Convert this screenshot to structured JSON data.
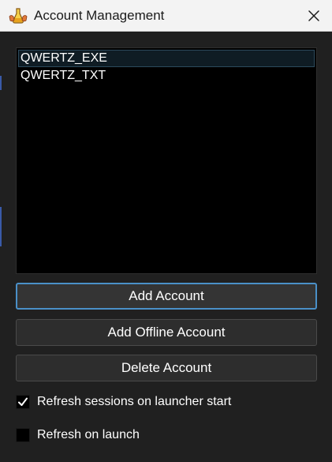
{
  "window": {
    "title": "Account Management",
    "icon": "app-logo-icon",
    "close_icon": "close-icon"
  },
  "accounts": [
    {
      "name": "QWERTZ_EXE",
      "selected": true
    },
    {
      "name": "QWERTZ_TXT",
      "selected": false
    }
  ],
  "buttons": {
    "add_account": "Add Account",
    "add_offline_account": "Add Offline Account",
    "delete_account": "Delete Account"
  },
  "options": {
    "refresh_sessions": {
      "label": "Refresh sessions on launcher start",
      "checked": true
    },
    "refresh_on_launch": {
      "label": "Refresh on launch",
      "checked": false
    }
  },
  "colors": {
    "background": "#202020",
    "titlebar": "#f3f3f3",
    "list_background": "#000000",
    "selection": "#0f1c24",
    "focus_border": "#4a90c8"
  }
}
